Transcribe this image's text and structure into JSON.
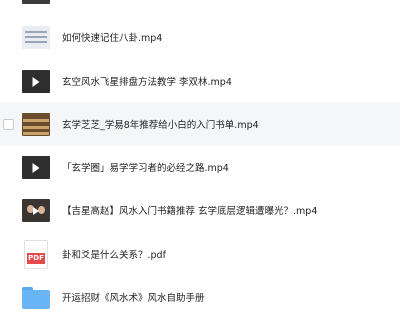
{
  "files": [
    {
      "name": "如何快速记住八卦.mp4",
      "thumb": "slide-thumbnail"
    },
    {
      "name": "玄空风水飞星排盘方法教学 李双林.mp4",
      "thumb": "video-thumbnail"
    },
    {
      "name": "玄学芝芝_学易8年推荐给小白的入门书单.mp4",
      "thumb": "bookshelf-thumbnail"
    },
    {
      "name": "「玄学圈」易学学习者的必经之路.mp4",
      "thumb": "video-thumbnail"
    },
    {
      "name": "【吉星高赵】风水入门书籍推荐 玄学底层逻辑遭曝光？.mp4",
      "thumb": "people-thumbnail"
    },
    {
      "name": "卦和爻是什么关系？.pdf",
      "thumb": "pdf-icon",
      "badge": "PDF"
    },
    {
      "name": "开运招财《风水术》风水自助手册",
      "thumb": "folder-icon"
    }
  ]
}
